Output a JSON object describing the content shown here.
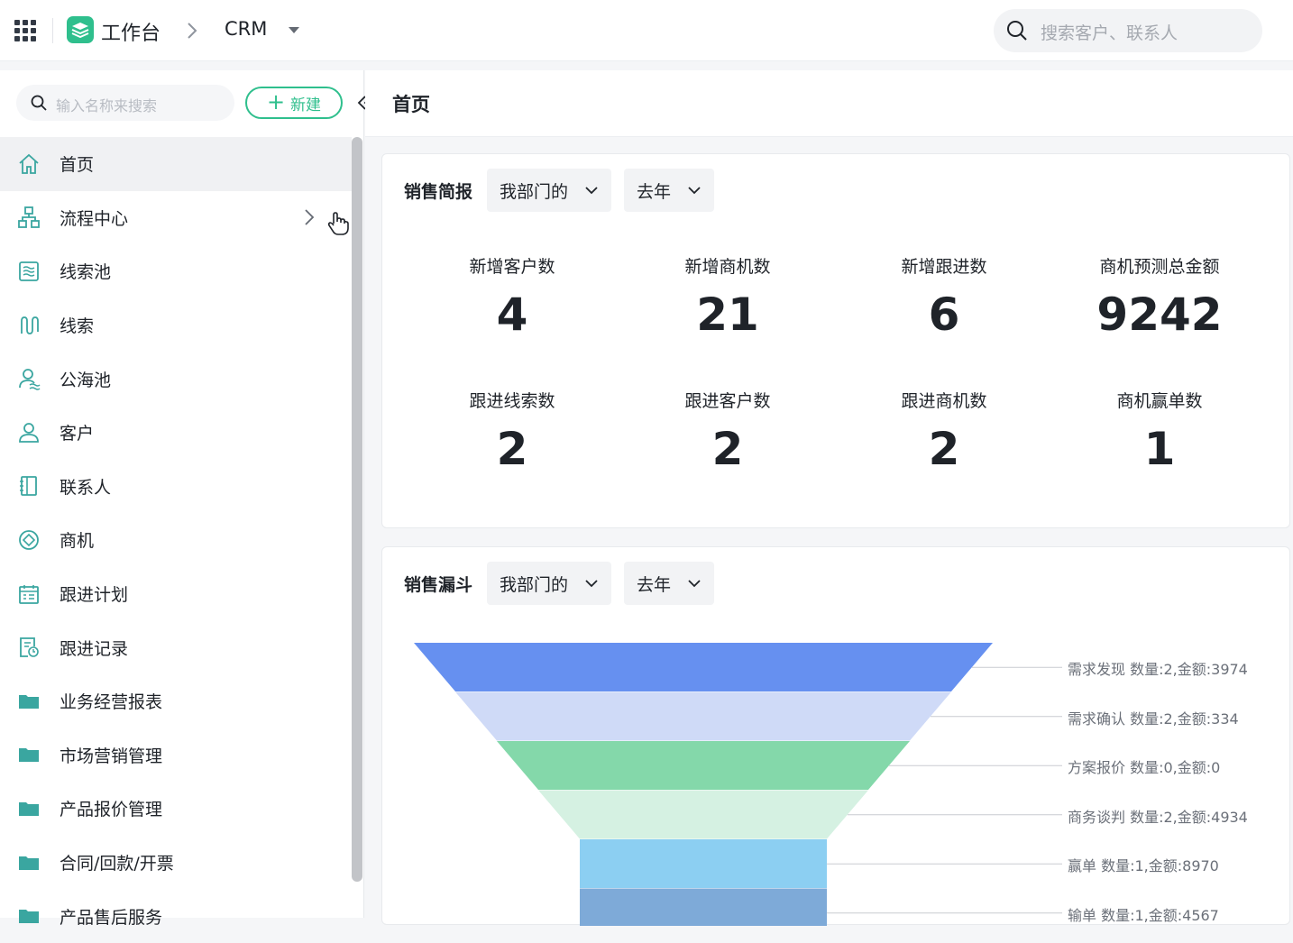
{
  "topbar": {
    "workbench": "工作台",
    "app": "CRM",
    "search_placeholder": "搜索客户、联系人"
  },
  "sidebar": {
    "search_placeholder": "输入名称来搜索",
    "new_label": "新建",
    "items": [
      {
        "label": "首页",
        "icon": "home-icon"
      },
      {
        "label": "流程中心",
        "icon": "flow-icon"
      },
      {
        "label": "线索池",
        "icon": "lead-pool-icon"
      },
      {
        "label": "线索",
        "icon": "lead-icon"
      },
      {
        "label": "公海池",
        "icon": "public-pool-icon"
      },
      {
        "label": "客户",
        "icon": "customer-icon"
      },
      {
        "label": "联系人",
        "icon": "contact-icon"
      },
      {
        "label": "商机",
        "icon": "opportunity-icon"
      },
      {
        "label": "跟进计划",
        "icon": "calendar-icon"
      },
      {
        "label": "跟进记录",
        "icon": "record-icon"
      },
      {
        "label": "业务经营报表",
        "icon": "folder-icon"
      },
      {
        "label": "市场营销管理",
        "icon": "folder-icon"
      },
      {
        "label": "产品报价管理",
        "icon": "folder-icon"
      },
      {
        "label": "合同/回款/开票",
        "icon": "folder-icon"
      },
      {
        "label": "产品售后服务",
        "icon": "folder-icon"
      }
    ]
  },
  "main": {
    "page_title": "首页",
    "brief": {
      "title": "销售简报",
      "scope": "我部门的",
      "period": "去年",
      "stats": [
        {
          "label": "新增客户数",
          "value": "4"
        },
        {
          "label": "新增商机数",
          "value": "21"
        },
        {
          "label": "新增跟进数",
          "value": "6"
        },
        {
          "label": "商机预测总金额",
          "value": "9242"
        },
        {
          "label": "跟进线索数",
          "value": "2"
        },
        {
          "label": "跟进客户数",
          "value": "2"
        },
        {
          "label": "跟进商机数",
          "value": "2"
        },
        {
          "label": "商机赢单数",
          "value": "1"
        }
      ]
    },
    "funnel": {
      "title": "销售漏斗",
      "scope": "我部门的",
      "period": "去年"
    }
  },
  "chart_data": {
    "type": "funnel",
    "stages": [
      {
        "name": "需求发现",
        "count": 2,
        "amount": 3974,
        "label": "需求发现 数量:2,金额:3974",
        "color": "#6690f0"
      },
      {
        "name": "需求确认",
        "count": 2,
        "amount": 334,
        "label": "需求确认 数量:2,金额:334",
        "color": "#cfdaf7"
      },
      {
        "name": "方案报价",
        "count": 0,
        "amount": 0,
        "label": "方案报价 数量:0,金额:0",
        "color": "#84d8aa"
      },
      {
        "name": "商务谈判",
        "count": 2,
        "amount": 4934,
        "label": "商务谈判 数量:2,金额:4934",
        "color": "#d5f1e2"
      },
      {
        "name": "赢单",
        "count": 1,
        "amount": 8970,
        "label": "赢单 数量:1,金额:8970",
        "color": "#8ccff2"
      },
      {
        "name": "输单",
        "count": 1,
        "amount": 4567,
        "label": "输单 数量:1,金额:4567",
        "color": "#7eaad8"
      }
    ]
  }
}
